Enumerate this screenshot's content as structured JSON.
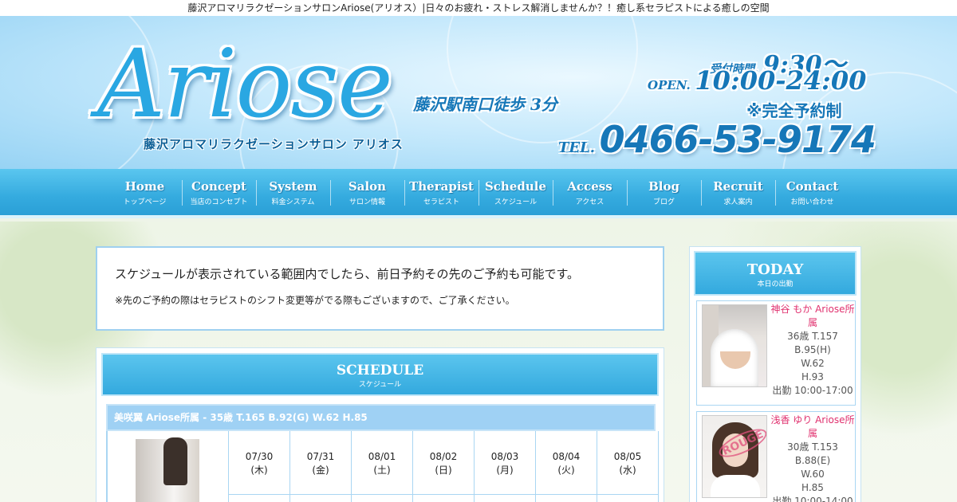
{
  "page_title": "藤沢アロマリラクゼーションサロンAriose(アリオス）|日々のお疲れ・ストレス解消しませんか？！癒し系セラピストによる癒しの空間",
  "header": {
    "logo": "Ariose",
    "logo_sub": "藤沢アロマリラクゼーションサロン アリオス",
    "station": "藤沢駅南口徒歩 3分",
    "reception_label": "受付時間.",
    "reception_time": "9:30〜",
    "open_label": "OPEN.",
    "open_time": "10:00-24:00",
    "reservation": "※完全予約制",
    "tel_label": "TEL.",
    "tel": "0466-53-9174"
  },
  "nav": [
    {
      "en": "Home",
      "jp": "トップページ"
    },
    {
      "en": "Concept",
      "jp": "当店のコンセプト"
    },
    {
      "en": "System",
      "jp": "料金システム"
    },
    {
      "en": "Salon",
      "jp": "サロン情報"
    },
    {
      "en": "Therapist",
      "jp": "セラピスト"
    },
    {
      "en": "Schedule",
      "jp": "スケジュール"
    },
    {
      "en": "Access",
      "jp": "アクセス"
    },
    {
      "en": "Blog",
      "jp": "ブログ"
    },
    {
      "en": "Recruit",
      "jp": "求人案内"
    },
    {
      "en": "Contact",
      "jp": "お問い合わせ"
    }
  ],
  "notice": {
    "line1": "スケジュールが表示されている範囲内でしたら、前日予約その先のご予約も可能です。",
    "line2": "※先のご予約の際はセラピストのシフト変更等がでる際もございますので、ご了承ください。"
  },
  "schedule": {
    "title": "SCHEDULE",
    "subtitle": "スケジュール",
    "person": "美咲翼 Ariose所属 - 35歳 T.165 B.92(G) W.62 H.85",
    "days": [
      {
        "date": "07/30",
        "dow": "(木)"
      },
      {
        "date": "07/31",
        "dow": "(金)"
      },
      {
        "date": "08/01",
        "dow": "(土)"
      },
      {
        "date": "08/02",
        "dow": "(日)"
      },
      {
        "date": "08/03",
        "dow": "(月)"
      },
      {
        "date": "08/04",
        "dow": "(火)"
      },
      {
        "date": "08/05",
        "dow": "(水)"
      }
    ]
  },
  "today": {
    "title": "TODAY",
    "subtitle": "本日の出勤",
    "therapists": [
      {
        "name": "神谷 もか Ariose所属",
        "age_height": "36歳 T.157",
        "bust": "B.95(H)",
        "waist": "W.62",
        "hip": "H.93",
        "shift": "出勤 10:00-17:00"
      },
      {
        "name": "浅香 ゆり Ariose所属",
        "age_height": "30歳 T.153",
        "bust": "B.88(E)",
        "waist": "W.60",
        "hip": "H.85",
        "shift": "出勤 10:00-14:00",
        "stamp": "ROUGE"
      }
    ]
  }
}
